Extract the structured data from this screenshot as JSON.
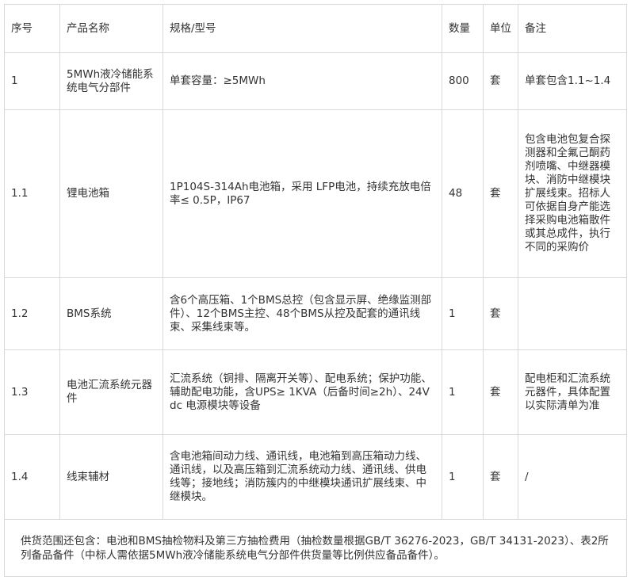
{
  "header": {
    "seq": "序号",
    "name": "产品名称",
    "spec": "规格/型号",
    "qty": "数量",
    "unit": "单位",
    "remark": "备注"
  },
  "rows": [
    {
      "seq": "1",
      "name": "5MWh液冷储能系统电气分部件",
      "spec": "单套容量：≥5MWh",
      "qty": "800",
      "unit": "套",
      "remark": "单套包含1.1~1.4"
    },
    {
      "seq": "1.1",
      "name": "锂电池箱",
      "spec": "1P104S-314Ah电池箱，采用 LFP电池，持续充放电倍率≤ 0.5P，IP67",
      "qty": "48",
      "unit": "套",
      "remark": "包含电池包复合探测器和全氟己酮药剂喷嘴、中继器模块、消防中继模块扩展线束。招标人可依据自身产能选择采购电池箱散件或其总成件，执行不同的采购价"
    },
    {
      "seq": "1.2",
      "name": "BMS系统",
      "spec": "含6个高压箱、1个BMS总控（包含显示屏、绝缘监测部件）、12个BMS主控、48个BMS从控及配套的通讯线束、采集线束等。",
      "qty": "1",
      "unit": "套",
      "remark": ""
    },
    {
      "seq": "1.3",
      "name": "电池汇流系统元器件",
      "spec": "汇流系统（铜排、隔离开关等）、配电系统；保护功能、辅助配电功能，含UPS≥ 1KVA（后备时间≥2h）、24Vdc 电源模块等设备",
      "qty": "1",
      "unit": "套",
      "remark": "配电柜和汇流系统元器件，具体配置以实际清单为准"
    },
    {
      "seq": "1.4",
      "name": "线束辅材",
      "spec": "含电池箱间动力线、通讯线，电池箱到高压箱动力线、通讯线，以及高压箱到汇流系统动力线、通讯线、供电线等；接地线；消防簇内的中继模块通讯扩展线束、中继模块。",
      "qty": "1",
      "unit": "套",
      "remark": "/"
    }
  ],
  "footer": "供货范围还包含：电池和BMS抽检物料及第三方抽检费用（抽检数量根据GB/T 36276-2023，GB/T 34131-2023）、表2所列备品备件（中标人需依据5MWh液冷储能系统电气分部件供货量等比例供应备品备件）。"
}
